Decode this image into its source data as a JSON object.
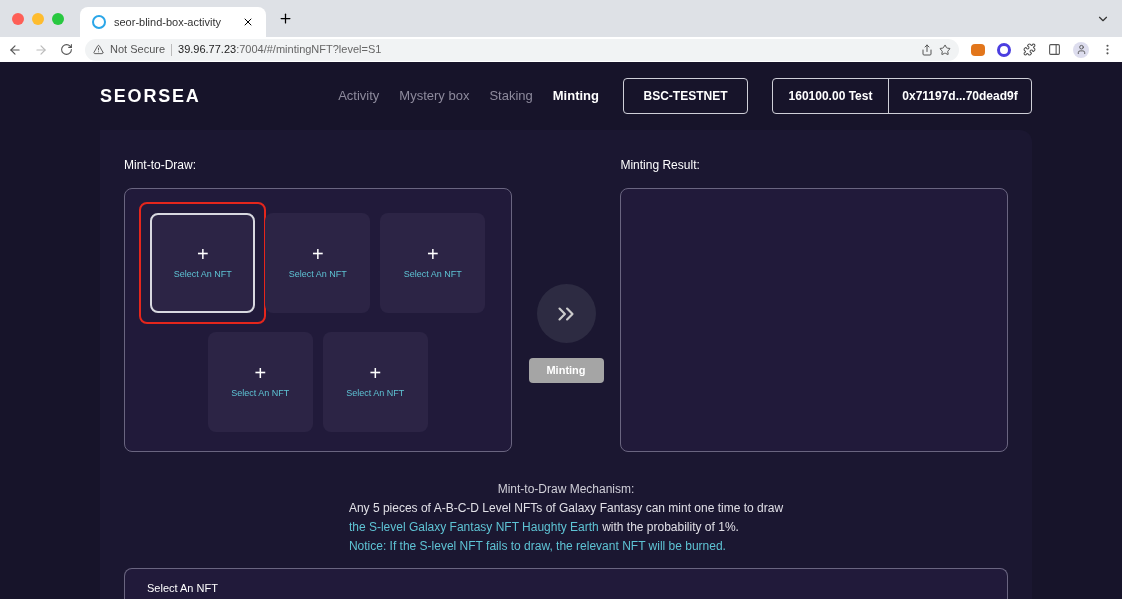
{
  "browser": {
    "tab_title": "seor-blind-box-activity",
    "security": "Not Secure",
    "url_host": "39.96.77.23",
    "url_rest": ":7004/#/mintingNFT?level=S1"
  },
  "header": {
    "logo": "SEORSEA",
    "nav": [
      {
        "label": "Activity",
        "selected": false
      },
      {
        "label": "Mystery box",
        "selected": false
      },
      {
        "label": "Staking",
        "selected": false
      },
      {
        "label": "Minting",
        "selected": true
      }
    ],
    "network": "BSC-TESTNET",
    "balance": "160100.00 Test",
    "address": "0x71197d...70dead9f"
  },
  "mint": {
    "title": "Mint-to-Draw:",
    "slots": [
      {
        "plus": "+",
        "label": "Select An NFT",
        "selected": true
      },
      {
        "plus": "+",
        "label": "Select An NFT",
        "selected": false
      },
      {
        "plus": "+",
        "label": "Select An NFT",
        "selected": false
      },
      {
        "plus": "+",
        "label": "Select An NFT",
        "selected": false
      },
      {
        "plus": "+",
        "label": "Select An NFT",
        "selected": false
      }
    ],
    "button": "Minting",
    "result_title": "Minting Result:"
  },
  "mechanism": {
    "title": "Mint-to-Draw Mechanism:",
    "line1": "Any 5 pieces of A-B-C-D Level NFTs of Galaxy Fantasy can mint one time to draw",
    "line2_highlight": "the S-level Galaxy Fantasy NFT Haughty Earth",
    "line2_rest": "with the probability of 1%.",
    "notice": "Notice: If the S-level NFT fails to draw, the relevant NFT will be burned."
  },
  "select_panel": {
    "title": "Select An NFT"
  }
}
